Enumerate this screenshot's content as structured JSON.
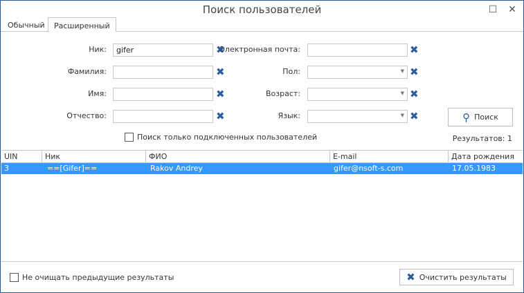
{
  "window": {
    "title": "Поиск пользователей",
    "maximize_icon": "maximize-icon",
    "close_icon": "close-icon"
  },
  "tabs": [
    {
      "label": "Обычный",
      "active": false
    },
    {
      "label": "Расширенный",
      "active": true
    }
  ],
  "form": {
    "nick": {
      "label": "Ник:",
      "value": "gifer"
    },
    "lastname": {
      "label": "Фамилия:",
      "value": ""
    },
    "firstname": {
      "label": "Имя:",
      "value": ""
    },
    "patronymic": {
      "label": "Отчество:",
      "value": ""
    },
    "email": {
      "label": "Электронная почта:",
      "value": ""
    },
    "gender": {
      "label": "Пол:",
      "value": ""
    },
    "age": {
      "label": "Возраст:",
      "value": ""
    },
    "language": {
      "label": "Язык:",
      "value": ""
    },
    "online_only": {
      "label": "Поиск только подключенных пользователей",
      "checked": false
    },
    "search_button": "Поиск",
    "results": "Результатов: 1"
  },
  "grid": {
    "columns": [
      "UIN",
      "Ник",
      "ФИО",
      "E-mail",
      "Дата рождения"
    ],
    "rows": [
      [
        "3",
        "==[Gifer]==",
        "Rakov Andrey",
        "gifer@nsoft-s.com",
        "17.05.1983"
      ]
    ],
    "selected_color": "#3399ff"
  },
  "footer": {
    "keep_results": {
      "label": "Не очищать предыдущие результаты",
      "checked": false
    },
    "clear_button": "Очистить результаты"
  }
}
